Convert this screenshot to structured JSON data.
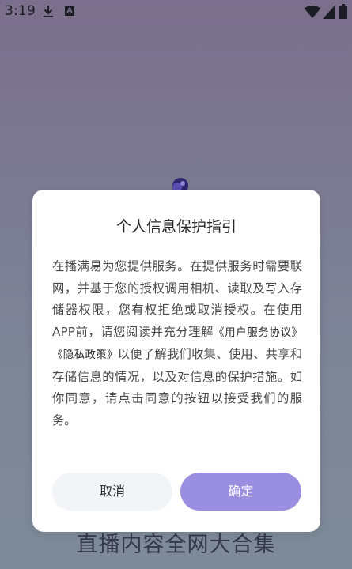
{
  "status_bar": {
    "time": "3:19",
    "download_icon": "download-icon",
    "notification_icon": "a-notification-icon",
    "wifi_icon": "wifi-icon",
    "signal_icon": "signal-icon",
    "battery_icon": "battery-icon"
  },
  "background": {
    "slogan": "直播内容全网大合集",
    "logo_icon": "app-logo-icon"
  },
  "dialog": {
    "title": "个人信息保护指引",
    "body_part1": "在播满易为您提供服务。在提供服务时需要联网，并基于您的授权调用相机、读取及写入存储器权限，您有权拒绝或取消授权。在使用APP前，请您阅读并充分理解",
    "user_agreement_link": "《用户服务协议》",
    "privacy_policy_link": "《隐私政策》",
    "body_part2": "以便了解我们收集、使用、共享和存储信息的情况，以及对信息的保护措施。如你同意，请点击同意的按钮以接受我们的服务。",
    "cancel_label": "取消",
    "confirm_label": "确定"
  },
  "colors": {
    "accent": "#9a8ee0",
    "cancel_bg": "#f2f4f8",
    "overlay": "#7d7f93"
  }
}
